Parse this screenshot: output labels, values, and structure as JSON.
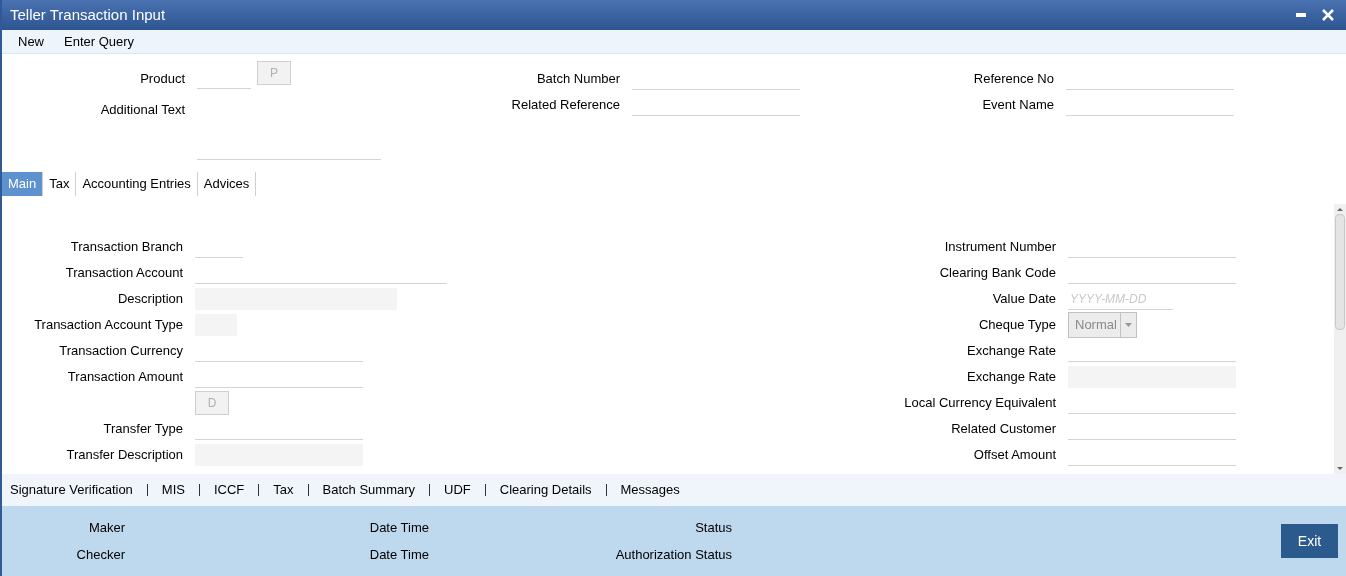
{
  "window": {
    "title": "Teller Transaction Input"
  },
  "menu": [
    "New",
    "Enter Query"
  ],
  "header": {
    "columns": [
      [
        {
          "label": "Product",
          "kind": "lookup",
          "button": "P"
        },
        {
          "label": "Additional Text",
          "kind": "textarea"
        }
      ],
      [
        {
          "label": "Batch Number",
          "kind": "text"
        },
        {
          "label": "Related Reference",
          "kind": "text"
        }
      ],
      [
        {
          "label": "Reference No",
          "kind": "text"
        },
        {
          "label": "Event Name",
          "kind": "text"
        }
      ]
    ]
  },
  "tabs": [
    {
      "label": "Main",
      "selected": true
    },
    {
      "label": "Tax",
      "selected": false
    },
    {
      "label": "Accounting Entries",
      "selected": false
    },
    {
      "label": "Advices",
      "selected": false
    }
  ],
  "main": {
    "left_fields": [
      {
        "label": "Transaction Branch",
        "kind": "text"
      },
      {
        "label": "Transaction Account",
        "kind": "text"
      },
      {
        "label": "Description",
        "kind": "readonly"
      },
      {
        "label": "Transaction Account Type",
        "kind": "readonly"
      },
      {
        "label": "Transaction Currency",
        "kind": "text"
      },
      {
        "label": "Transaction Amount",
        "kind": "text"
      },
      {
        "kind": "button",
        "button": "D"
      },
      {
        "label": "Transfer Type",
        "kind": "text"
      },
      {
        "label": "Transfer Description",
        "kind": "readonly"
      }
    ],
    "right_fields": [
      {
        "label": "Instrument Number",
        "kind": "text"
      },
      {
        "label": "Clearing Bank Code",
        "kind": "text"
      },
      {
        "label": "Value Date",
        "kind": "date",
        "placeholder": "YYYY-MM-DD"
      },
      {
        "label": "Cheque Type",
        "kind": "select",
        "value": "Normal",
        "disabled": true
      },
      {
        "label": "Exchange Rate",
        "kind": "text"
      },
      {
        "label": "Exchange Rate",
        "kind": "readonly"
      },
      {
        "label": "Local Currency Equivalent",
        "kind": "text"
      },
      {
        "label": "Related Customer",
        "kind": "text"
      },
      {
        "label": "Offset Amount",
        "kind": "text"
      }
    ]
  },
  "bottom_links": [
    "Signature Verification",
    "MIS",
    "ICCF",
    "Tax",
    "Batch Summary",
    "UDF",
    "Clearing Details",
    "Messages"
  ],
  "audit": [
    [
      "Maker",
      "Date Time",
      "Status"
    ],
    [
      "Checker",
      "Date Time",
      "Authorization Status"
    ]
  ],
  "exit_button": "Exit"
}
